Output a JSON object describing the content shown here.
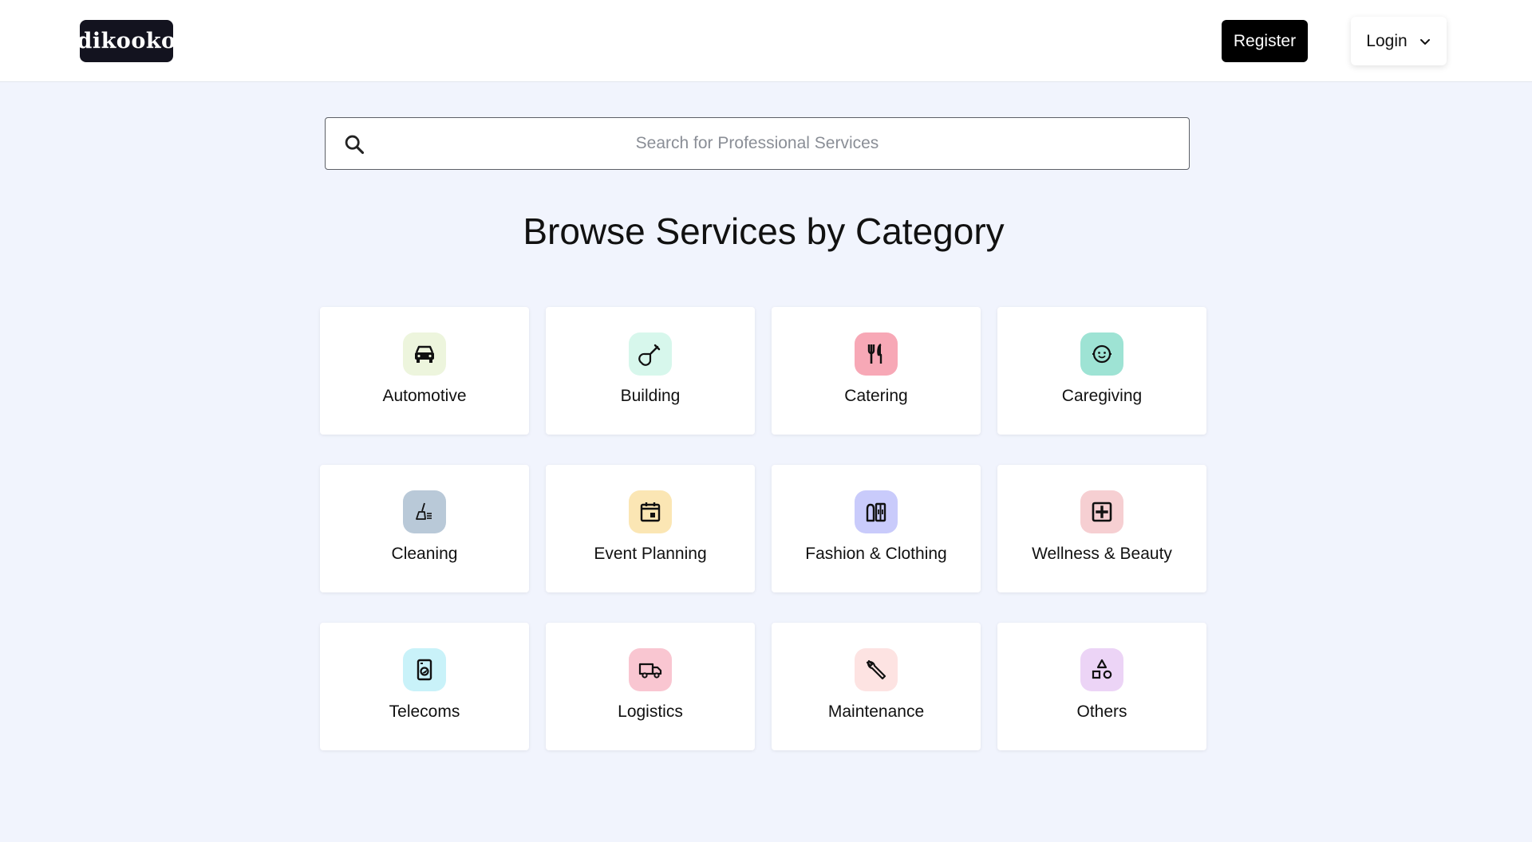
{
  "header": {
    "logo_text": "dikooko",
    "register_label": "Register",
    "login_label": "Login"
  },
  "search": {
    "placeholder": "Search for Professional Services",
    "value": ""
  },
  "page_title": "Browse Services by Category",
  "categories": [
    {
      "label": "Automotive",
      "icon": "car-icon",
      "color": "#edf5dd"
    },
    {
      "label": "Building",
      "icon": "shovel-icon",
      "color": "#d7f7ec"
    },
    {
      "label": "Catering",
      "icon": "utensils-icon",
      "color": "#f7a8b6"
    },
    {
      "label": "Caregiving",
      "icon": "baby-face-icon",
      "color": "#9ee3d4"
    },
    {
      "label": "Cleaning",
      "icon": "broom-icon",
      "color": "#b9c9d8"
    },
    {
      "label": "Event Planning",
      "icon": "calendar-icon",
      "color": "#fbe6b4"
    },
    {
      "label": "Fashion & Clothing",
      "icon": "wardrobe-icon",
      "color": "#c9cbfb"
    },
    {
      "label": "Wellness & Beauty",
      "icon": "medical-plus-icon",
      "color": "#f6cfd2"
    },
    {
      "label": "Telecoms",
      "icon": "device-icon",
      "color": "#c9f2f9"
    },
    {
      "label": "Logistics",
      "icon": "truck-icon",
      "color": "#f9c6d1"
    },
    {
      "label": "Maintenance",
      "icon": "wrench-icon",
      "color": "#fde3e2"
    },
    {
      "label": "Others",
      "icon": "shapes-icon",
      "color": "#ecd4f6"
    }
  ]
}
